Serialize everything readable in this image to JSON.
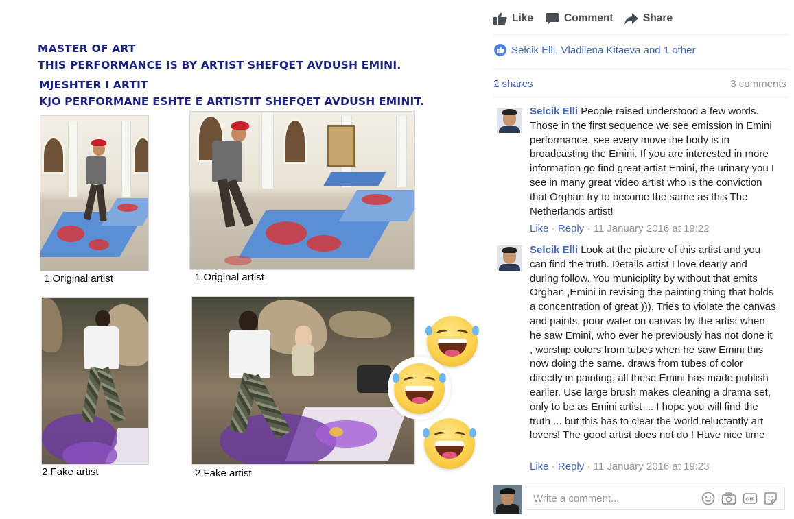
{
  "poster": {
    "title_en_1": "MASTER OF ART",
    "title_en_2": "THIS PERFORMANCE IS BY ARTIST SHEFQET AVDUSH EMINI.",
    "title_sq_1": "MJESHTER I ARTIT",
    "title_sq_2": "KJO PERFORMANE ESHTE E ARTISTIT SHEFQET AVDUSH EMINIT.",
    "photos": [
      {
        "caption": "1.Original artist",
        "kind": "original"
      },
      {
        "caption": "1.Original artist",
        "kind": "original"
      },
      {
        "caption": "2.Fake artist",
        "kind": "fake"
      },
      {
        "caption": "2.Fake artist",
        "kind": "fake"
      }
    ],
    "emojis": [
      "laughing-emoji",
      "laughing-emoji",
      "laughing-emoji"
    ]
  },
  "post_actions": {
    "like": "Like",
    "comment": "Comment",
    "share": "Share"
  },
  "reactions": {
    "summary": "Selcik Elli, Vladilena Kitaeva and 1 other",
    "shares": "2 shares",
    "comments": "3 comments"
  },
  "comments": [
    {
      "author": "Selcik Elli",
      "text": "People raised understood a few words. Those in the first sequence we see emission in Emini performance. see every move the body is in broadcasting the Emini. If you are interested in more information go find great artist Emini, the urinary you I see in many great video artist who is the conviction that Orghan try to become the same as this The Netherlands artist!",
      "like": "Like",
      "reply": "Reply",
      "timestamp": "11 January 2016 at 19:22"
    },
    {
      "author": "Selcik Elli",
      "text": "Look at the picture of this artist and you can find the truth. Details artist I love dearly and during follow. You municiplity by without that emits Orghan ,Emini in revising the painting thing that holds a concentration of great ))). Tries to violate the canvas and paints, pour water on canvas by the artist when he saw Emini, who ever he previously has not done it , worship colors from tubes when he saw Emini this now doing the same. draws from tubes of color directly in painting, all these Emini has made publish earlier. Use large brush makes cleaning a drama set, only to be as Emini artist ... I hope you will find the truth ... but this has to clear the world reluctantly art lovers! The good artist does not do ! Have nice time",
      "like": "Like",
      "reply": "Reply",
      "timestamp": "11 January 2016 at 19:23"
    }
  ],
  "write_comment": {
    "placeholder": "Write a comment...",
    "icons": [
      "emoji-icon",
      "camera-icon",
      "gif-icon",
      "sticker-icon"
    ]
  },
  "colors": {
    "link_blue": "#4267b2",
    "poster_navy": "#1a237e",
    "meta_gray": "#90949c"
  }
}
